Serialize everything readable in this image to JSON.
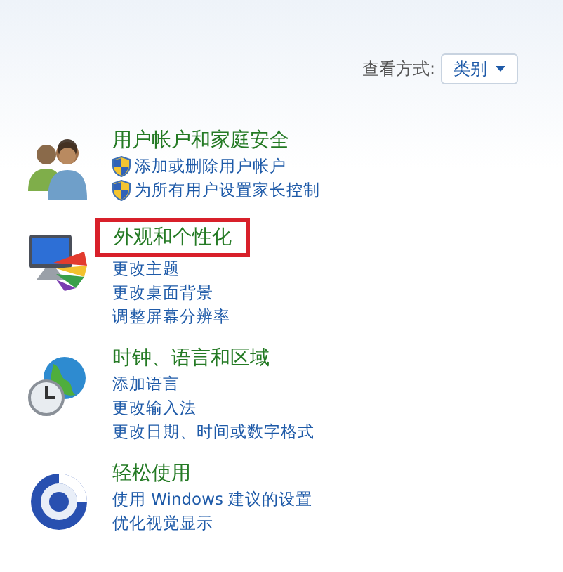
{
  "view_by": {
    "label": "查看方式:",
    "value": "类别"
  },
  "categories": [
    {
      "kind": "users",
      "title": "用户帐户和家庭安全",
      "highlighted": false,
      "links": [
        {
          "label": "添加或删除用户帐户",
          "shield": true
        },
        {
          "label": "为所有用户设置家长控制",
          "shield": true
        }
      ]
    },
    {
      "kind": "appearance",
      "title": "外观和个性化",
      "highlighted": true,
      "links": [
        {
          "label": "更改主题",
          "shield": false
        },
        {
          "label": "更改桌面背景",
          "shield": false
        },
        {
          "label": "调整屏幕分辨率",
          "shield": false
        }
      ]
    },
    {
      "kind": "clock",
      "title": "时钟、语言和区域",
      "highlighted": false,
      "links": [
        {
          "label": "添加语言",
          "shield": false
        },
        {
          "label": "更改输入法",
          "shield": false
        },
        {
          "label": "更改日期、时间或数字格式",
          "shield": false
        }
      ]
    },
    {
      "kind": "ease",
      "title": "轻松使用",
      "highlighted": false,
      "links": [
        {
          "label": "使用 Windows 建议的设置",
          "shield": false
        },
        {
          "label": "优化视觉显示",
          "shield": false
        }
      ]
    }
  ]
}
